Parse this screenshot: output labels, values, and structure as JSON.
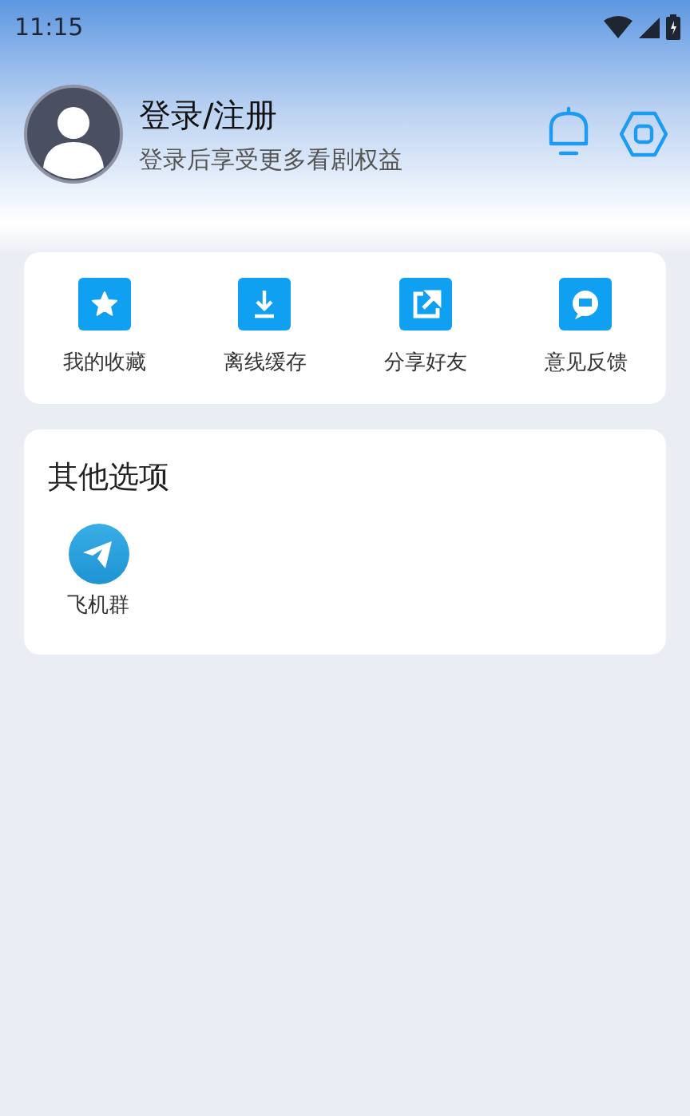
{
  "status_bar": {
    "time": "11:15"
  },
  "profile": {
    "title": "登录/注册",
    "subtitle": "登录后享受更多看剧权益"
  },
  "quick_actions": [
    {
      "kind": "star",
      "label": "我的收藏"
    },
    {
      "kind": "download",
      "label": "离线缓存"
    },
    {
      "kind": "share",
      "label": "分享好友"
    },
    {
      "kind": "chat",
      "label": "意见反馈"
    }
  ],
  "other_options": {
    "title": "其他选项",
    "items": [
      {
        "kind": "paper-plane",
        "label": "飞机群"
      }
    ]
  }
}
